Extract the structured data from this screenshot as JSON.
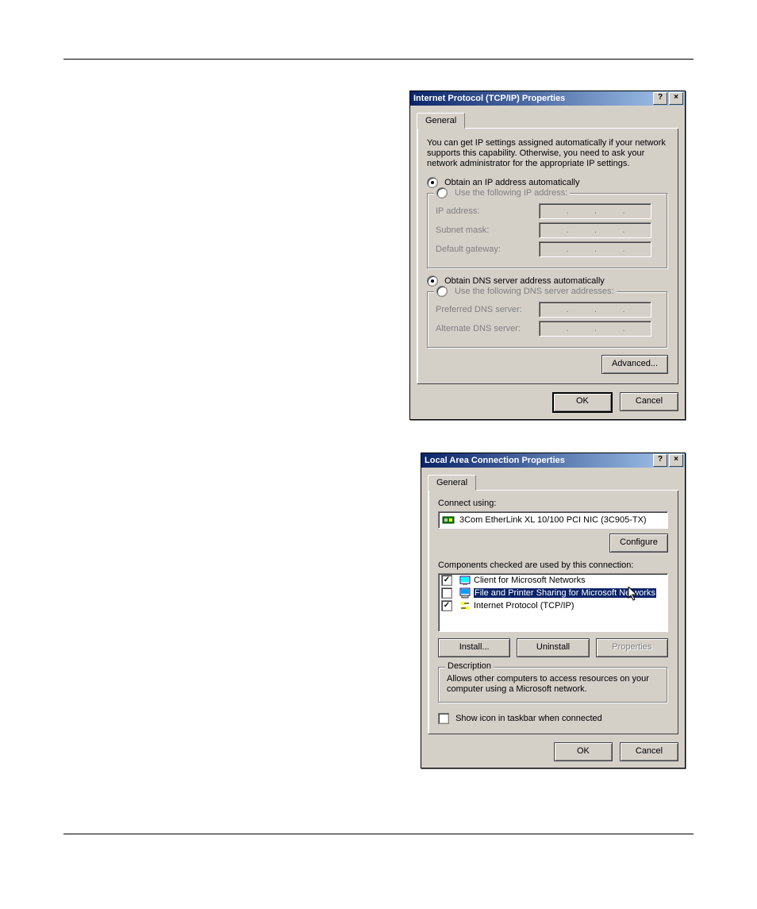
{
  "dialog1": {
    "title": "Internet Protocol (TCP/IP) Properties",
    "tab": "General",
    "info": "You can get IP settings assigned automatically if your network supports this capability. Otherwise, you need to ask your network administrator for the appropriate IP settings.",
    "r_auto_ip": "Obtain an IP address automatically",
    "r_use_ip": "Use the following IP address:",
    "ip_label": "IP address:",
    "subnet_label": "Subnet mask:",
    "gw_label": "Default gateway:",
    "r_auto_dns": "Obtain DNS server address automatically",
    "r_use_dns": "Use the following DNS server addresses:",
    "pref_dns": "Preferred DNS server:",
    "alt_dns": "Alternate DNS server:",
    "advanced": "Advanced...",
    "ok": "OK",
    "cancel": "Cancel"
  },
  "dialog2": {
    "title": "Local Area Connection Properties",
    "tab": "General",
    "connect_using": "Connect using:",
    "nic": "3Com EtherLink XL 10/100 PCI NIC (3C905-TX)",
    "configure": "Configure",
    "components_label": "Components checked are used by this connection:",
    "items": [
      {
        "checked": true,
        "label": "Client for Microsoft Networks"
      },
      {
        "checked": false,
        "label": "File and Printer Sharing for Microsoft Networks"
      },
      {
        "checked": true,
        "label": "Internet Protocol (TCP/IP)"
      }
    ],
    "install": "Install...",
    "uninstall": "Uninstall",
    "properties": "Properties",
    "desc_title": "Description",
    "desc_text": "Allows other computers to access resources on your computer using a Microsoft network.",
    "show_icon": "Show icon in taskbar when connected",
    "ok": "OK",
    "cancel": "Cancel"
  }
}
